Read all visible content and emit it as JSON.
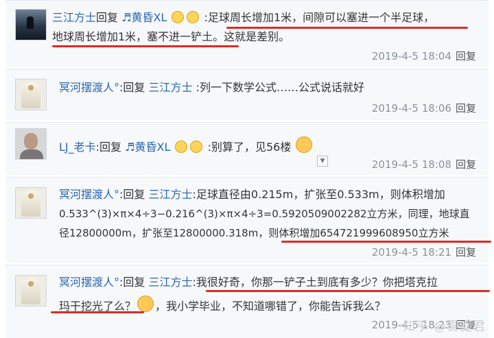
{
  "comments": [
    {
      "user": "三江方士",
      "reply_word": "回复",
      "target": "♬黄昏XL",
      "line1": ":足球周长增加1米，间隙可以塞进一个半足球，",
      "line2": "地球周长增加1米，塞不进一铲土。这就是差别。",
      "time": "2019-4-5 18:04",
      "reply": "回复"
    },
    {
      "user": "冥河摆渡人°",
      "reply_word": ":回复",
      "target": "三江方士",
      "line1": ":列一下数学公式……公式说话就好",
      "time": "2019-4-5 18:06",
      "reply": "回复"
    },
    {
      "user": "LJ_老卡",
      "reply_word": ":回复",
      "target": "♬黄昏XL",
      "line1": ":别算了，见56楼",
      "time": "2019-4-5 18:08",
      "reply": "回复"
    },
    {
      "user": "冥河摆渡人°",
      "reply_word": ":回复",
      "target": "三江方士",
      "line1": ":足球直径由0.215m，扩张至0.533m，则体积增加",
      "line2": "0.533^(3)×π×4÷3−0.216^(3)×π×4÷3=0.5920509002282立方米，同理，地球直",
      "line3a": "径12800000m，扩张至12800000.318m，",
      "line3b": "则体积增加654721999608950立方米",
      "time": "2019-4-5 18:21",
      "reply": "回复"
    },
    {
      "user": "冥河摆渡人°",
      "reply_word": ":回复",
      "target": "三江方士",
      "line1": ":我很好奇，你那一铲子土到底有多少？你把塔克拉",
      "line2a": "玛干挖光了么？",
      "line2b": "，我小学毕业，不知道哪错了，你能告诉我么？",
      "time": "2019-4-5 18:23",
      "reply": "回复"
    }
  ],
  "watermark": "知乎 @雾庭君",
  "colors": {
    "link": "#2b66b1",
    "underline": "#e02a24",
    "meta": "#8b929a"
  }
}
